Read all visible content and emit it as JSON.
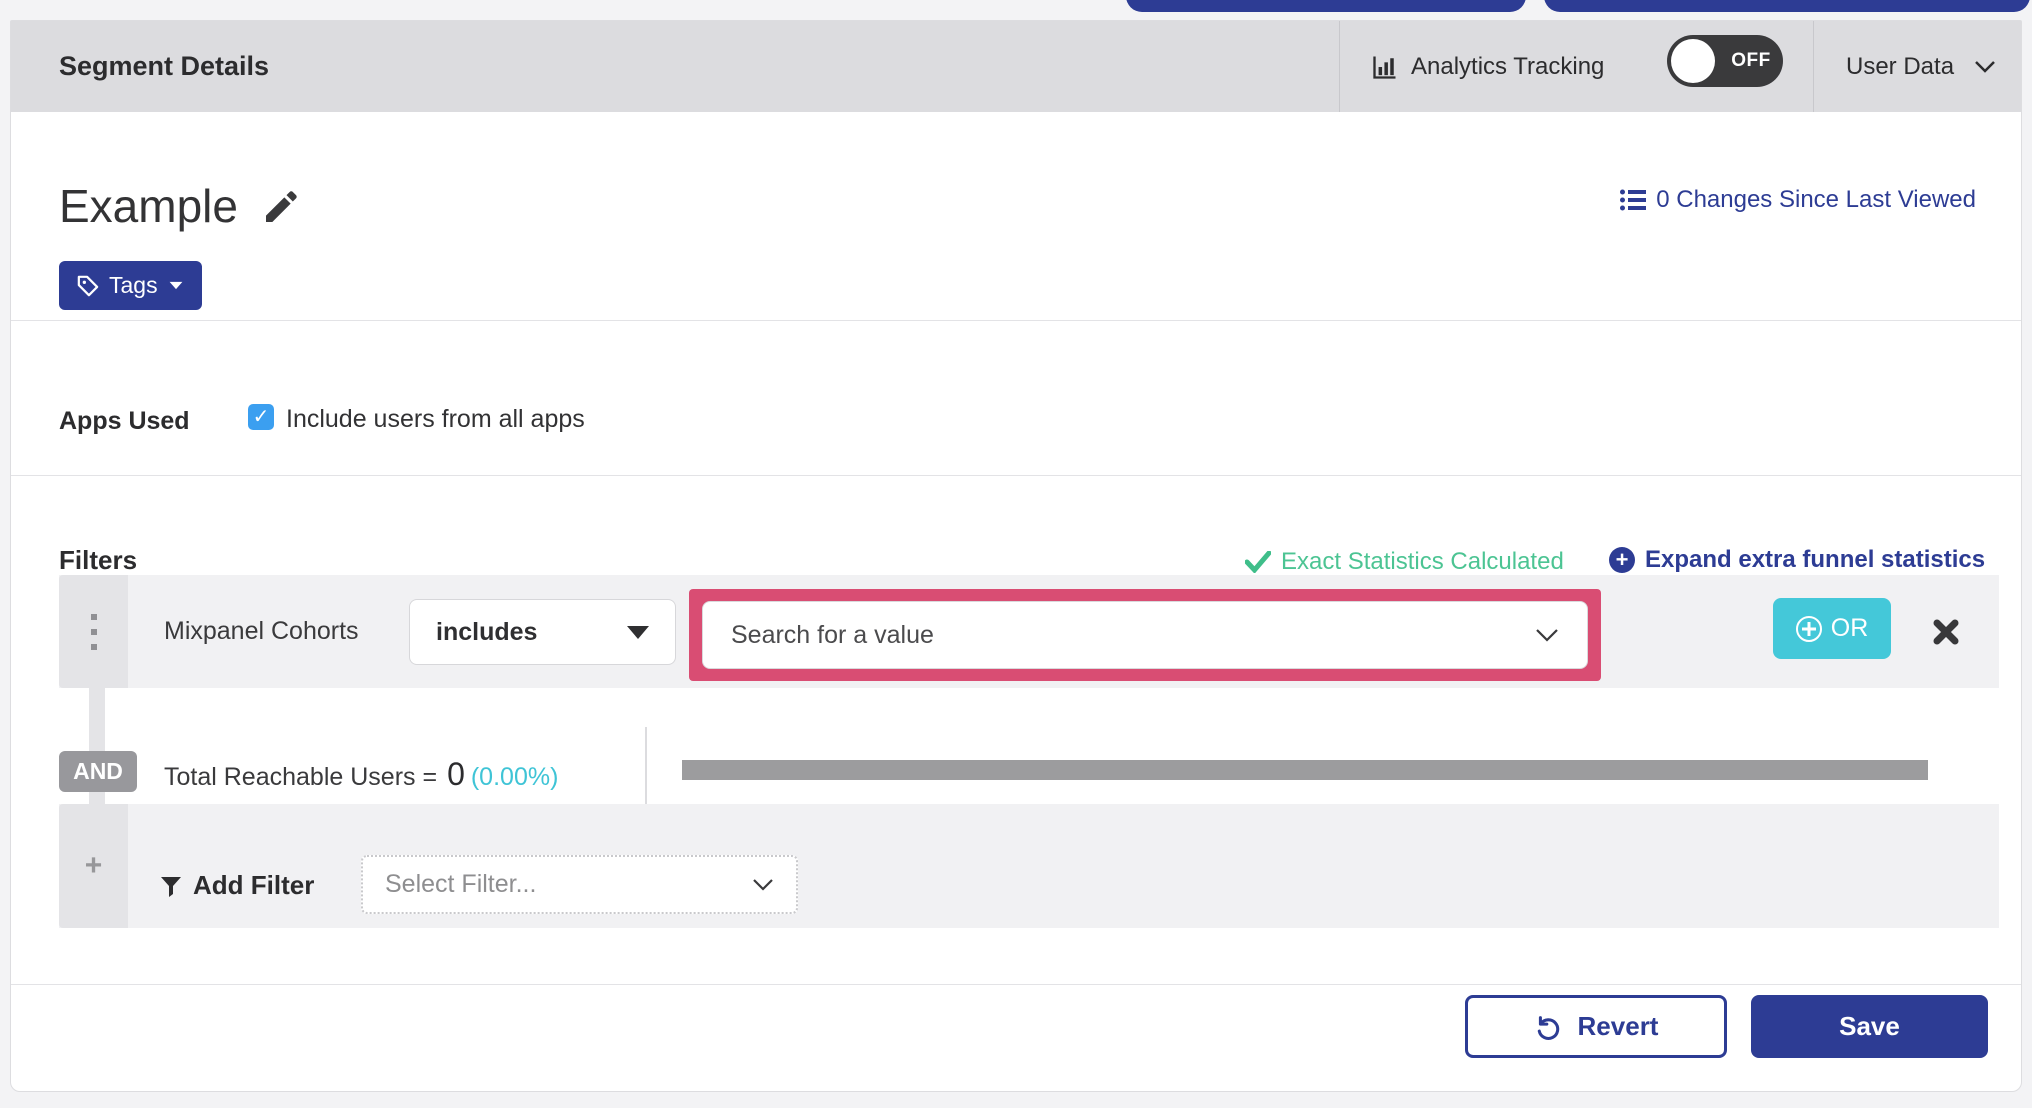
{
  "header": {
    "title": "Segment Details",
    "analytics_label": "Analytics Tracking",
    "analytics_toggle_state": "OFF",
    "user_data_label": "User Data"
  },
  "segment": {
    "name": "Example",
    "tags_button_label": "Tags",
    "changes_link": "0 Changes Since Last Viewed"
  },
  "apps_used": {
    "label": "Apps Used",
    "checkbox_label": "Include users from all apps",
    "checkbox_checked": true,
    "check_glyph": "✓"
  },
  "filters": {
    "heading": "Filters",
    "exact_statistics_label": "Exact Statistics Calculated",
    "expand_link_label": "Expand extra funnel statistics",
    "expand_plus_glyph": "+",
    "row1": {
      "filter_name": "Mixpanel Cohorts",
      "operator_value": "includes",
      "value_placeholder": "Search for a value",
      "or_button_label": "OR"
    },
    "connector_label": "AND",
    "reachable": {
      "label": "Total Reachable Users =",
      "value": "0",
      "percent": "(0.00%)",
      "progress_fraction": 0
    },
    "add_filter": {
      "plus_glyph": "+",
      "label": "Add Filter",
      "select_placeholder": "Select Filter..."
    }
  },
  "footer": {
    "revert_label": "Revert",
    "save_label": "Save"
  },
  "colors": {
    "brand_blue": "#2d3c94",
    "teal_or_button": "#44c8d9",
    "cyan_percent": "#3fc4d6",
    "green_exact_stats": "#4cc493",
    "pink_highlight": "#d94d73",
    "header_gray": "#dcdcdf",
    "row_gray": "#f1f1f3",
    "handle_gray": "#e4e4e7",
    "and_badge_gray": "#98989c",
    "progress_gray": "#9c9c9e",
    "toggle_dark": "#3a3a3c",
    "checkbox_blue": "#3b9ff0"
  }
}
